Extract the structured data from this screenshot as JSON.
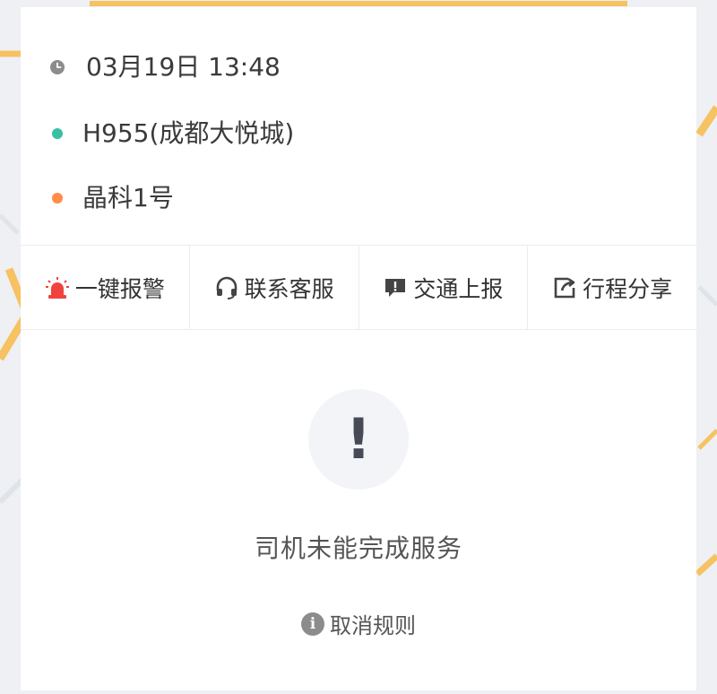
{
  "trip": {
    "time": "03月19日 13:48",
    "start": "H955(成都大悦城)",
    "end": "晶科1号"
  },
  "actions": [
    {
      "label": "一键报警",
      "icon": "alarm-icon"
    },
    {
      "label": "联系客服",
      "icon": "headset-icon"
    },
    {
      "label": "交通上报",
      "icon": "report-icon"
    },
    {
      "label": "行程分享",
      "icon": "share-icon"
    }
  ],
  "status": {
    "icon": "exclamation-icon",
    "message": "司机未能完成服务",
    "rules_label": "取消规则"
  },
  "colors": {
    "start_dot": "#39c0a2",
    "end_dot": "#ff8c48",
    "alarm_red": "#f0433d",
    "map_road": "#f7c66b"
  }
}
